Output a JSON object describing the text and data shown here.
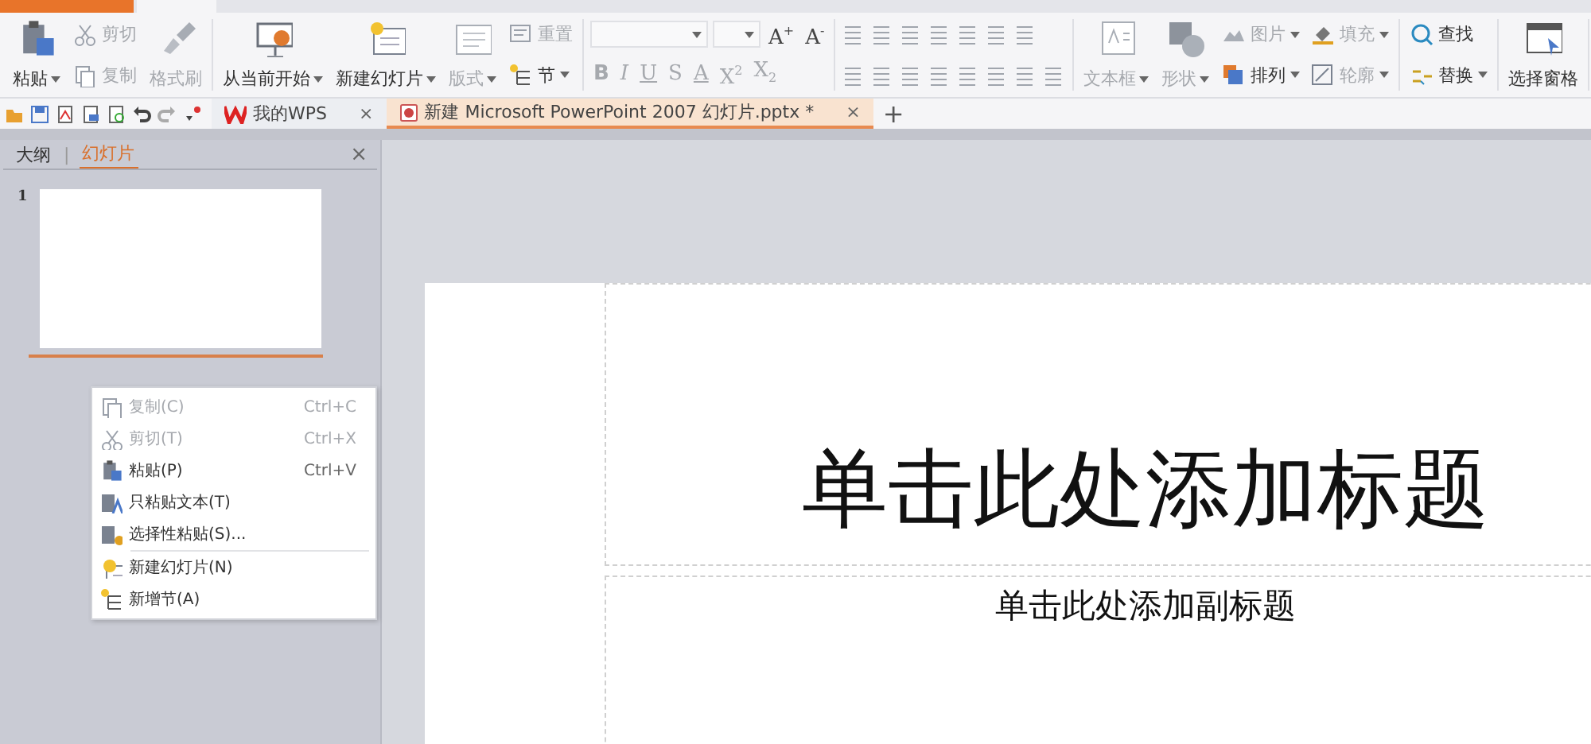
{
  "ribbon": {
    "groups": [
      {
        "columns": [
          {
            "kind": "large",
            "label": "粘贴",
            "dropdown": true,
            "disabled": false
          },
          {
            "kind": "stack",
            "rows": [
              [
                {
                  "kind": "button",
                  "label": "剪切",
                  "disabled": true,
                  "dropdown": false
                }
              ],
              [
                {
                  "kind": "button",
                  "label": "复制",
                  "disabled": true,
                  "dropdown": false
                }
              ]
            ]
          },
          {
            "kind": "large",
            "label": "格式刷",
            "dropdown": false,
            "disabled": true
          }
        ]
      },
      {
        "columns": [
          {
            "kind": "large",
            "label": "从当前开始",
            "dropdown": true,
            "disabled": false
          },
          {
            "kind": "large",
            "label": "新建幻灯片",
            "dropdown": true,
            "disabled": false
          },
          {
            "kind": "large",
            "label": "版式",
            "dropdown": true,
            "disabled": true
          },
          {
            "kind": "stack",
            "rows": [
              [
                {
                  "kind": "button",
                  "label": "重置",
                  "disabled": true,
                  "dropdown": false
                }
              ],
              [
                {
                  "kind": "button",
                  "label": "节",
                  "disabled": false,
                  "dropdown": true
                }
              ]
            ]
          }
        ]
      },
      {
        "columns": [
          {
            "kind": "stack",
            "rows": [
              [
                {
                  "kind": "field",
                  "disabled": true
                },
                {
                  "kind": "field",
                  "disabled": true
                },
                {
                  "kind": "glyph",
                  "label": "A$^{+}$",
                  "disabled": false
                },
                {
                  "kind": "glyph",
                  "label": "A$^{-}$",
                  "disabled": false
                }
              ],
              [
                {
                  "kind": "glyph",
                  "label": "B",
                  "disabled": true
                },
                {
                  "kind": "glyph",
                  "label": "I",
                  "disabled": true
                },
                {
                  "kind": "glyph",
                  "label": "U",
                  "disabled": true
                },
                {
                  "kind": "glyph",
                  "label": "S",
                  "disabled": true
                },
                {
                  "kind": "glyph",
                  "label": "A",
                  "disabled": true
                },
                {
                  "kind": "glyph",
                  "label": "X$^{2}$",
                  "disabled": true
                },
                {
                  "kind": "glyph",
                  "label": "X$_{2}$",
                  "disabled": true
                }
              ]
            ]
          }
        ]
      },
      {
        "columns": [
          {
            "kind": "stack",
            "rows": [
              [
                {
                  "kind": "icon",
                  "disabled": true
                },
                {
                  "kind": "icon",
                  "disabled": true
                },
                {
                  "kind": "icon",
                  "disabled": true
                },
                {
                  "kind": "icon",
                  "disabled": true
                },
                {
                  "kind": "icon",
                  "disabled": true
                },
                {
                  "kind": "icon",
                  "disabled": true
                },
                {
                  "kind": "icon",
                  "disabled": true
                }
              ],
              [
                {
                  "kind": "icon",
                  "disabled": true
                },
                {
                  "kind": "icon",
                  "disabled": true
                },
                {
                  "kind": "icon",
                  "disabled": true
                },
                {
                  "kind": "icon",
                  "disabled": true
                },
                {
                  "kind": "icon",
                  "disabled": true
                },
                {
                  "kind": "icon",
                  "disabled": true
                },
                {
                  "kind": "icon",
                  "disabled": true
                },
                {
                  "kind": "icon",
                  "disabled": true
                }
              ]
            ]
          }
        ]
      },
      {
        "columns": [
          {
            "kind": "large",
            "label": "文本框",
            "dropdown": true,
            "disabled": true
          },
          {
            "kind": "large",
            "label": "形状",
            "dropdown": true,
            "disabled": true
          },
          {
            "kind": "stack",
            "rows": [
              [
                {
                  "kind": "button",
                  "label": "图片",
                  "disabled": true,
                  "dropdown": true
                },
                {
                  "kind": "button",
                  "label": "填充",
                  "disabled": true,
                  "dropdown": true
                }
              ],
              [
                {
                  "kind": "button",
                  "label": "排列",
                  "disabled": false,
                  "dropdown": true
                },
                {
                  "kind": "button",
                  "label": "轮廓",
                  "disabled": true,
                  "dropdown": true
                }
              ]
            ]
          }
        ]
      },
      {
        "columns": [
          {
            "kind": "stack",
            "rows": [
              [
                {
                  "kind": "button",
                  "label": "查找",
                  "disabled": false,
                  "dropdown": false
                }
              ],
              [
                {
                  "kind": "button",
                  "label": "替换",
                  "disabled": false,
                  "dropdown": true
                }
              ]
            ]
          }
        ]
      },
      {
        "columns": [
          {
            "kind": "large",
            "label": "选择窗格",
            "dropdown": false,
            "disabled": false
          }
        ]
      }
    ]
  },
  "document_tabs": [
    {
      "label": "我的WPS",
      "close": "×",
      "selected": false
    },
    {
      "label": "新建 Microsoft PowerPoint 2007 幻灯片.pptx *",
      "close": "×",
      "selected": true
    }
  ],
  "new_tab": "+",
  "side_panel": {
    "tabs": [
      {
        "label": "大纲",
        "selected": false
      },
      {
        "label": "幻灯片",
        "selected": true
      }
    ],
    "separator": "|",
    "close": "×",
    "thumbnails": [
      {
        "number": "1",
        "selected": true
      }
    ]
  },
  "context_menu": [
    {
      "label": "复制(C)",
      "shortcut": "Ctrl+C",
      "disabled": true,
      "divider_before": false
    },
    {
      "label": "剪切(T)",
      "shortcut": "Ctrl+X",
      "disabled": true,
      "divider_before": false
    },
    {
      "label": "粘贴(P)",
      "shortcut": "Ctrl+V",
      "disabled": false,
      "divider_before": false
    },
    {
      "label": "只粘贴文本(T)",
      "disabled": false,
      "divider_before": false
    },
    {
      "label": "选择性粘贴(S)...",
      "disabled": false,
      "divider_before": false
    },
    {
      "label": "新建幻灯片(N)",
      "disabled": false,
      "divider_before": true
    },
    {
      "label": "新增节(A)",
      "disabled": false,
      "divider_before": false
    }
  ],
  "slide": {
    "title_placeholder": "单击此处添加标题",
    "subtitle_placeholder": "单击此处添加副标题"
  }
}
